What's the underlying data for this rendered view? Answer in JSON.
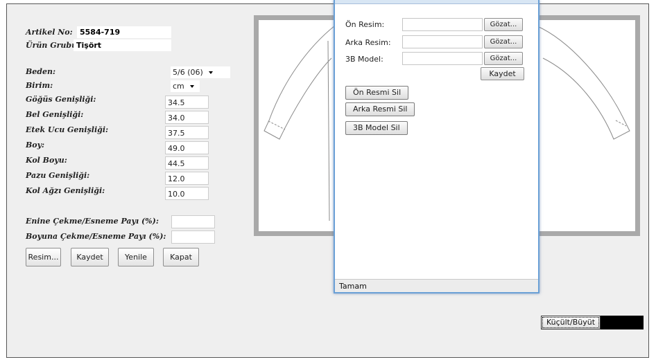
{
  "product": {
    "article_label": "Artikel No:",
    "article_value": "5584-719",
    "group_label": "Ürün Grubu:",
    "group_value": "Tişört"
  },
  "size": {
    "label": "Beden:",
    "value": "5/6 (06)"
  },
  "unit": {
    "label": "Birim:",
    "value": "cm"
  },
  "measurements": [
    {
      "label": "Göğüs Genişliği:",
      "value": "34.5"
    },
    {
      "label": "Bel Genişliği:",
      "value": "34.0"
    },
    {
      "label": "Etek Ucu Genişliği:",
      "value": "37.5"
    },
    {
      "label": "Boy:",
      "value": "49.0"
    },
    {
      "label": "Kol Boyu:",
      "value": "44.5"
    },
    {
      "label": "Pazu Genişliği:",
      "value": "12.0"
    },
    {
      "label": "Kol Ağzı Genişliği:",
      "value": "10.0"
    }
  ],
  "shrinkage": {
    "width_label": "Enine Çekme/Esneme Payı (%):",
    "width_value": "",
    "length_label": "Boyuna Çekme/Esneme Payı (%):",
    "length_value": ""
  },
  "actions": {
    "image": "Resim...",
    "save": "Kaydet",
    "refresh": "Yenile",
    "close": "Kapat"
  },
  "popup": {
    "front_label": "Ön Resim:",
    "back_label": "Arka Resim:",
    "model_label": "3B Model:",
    "browse": "Gözat...",
    "save": "Kaydet",
    "delete_front": "Ön Resmi Sil",
    "delete_back": "Arka Resmi Sil",
    "delete_model": "3B Model Sil",
    "status": "Tamam"
  },
  "resize_label": "Küçült/Büyüt"
}
